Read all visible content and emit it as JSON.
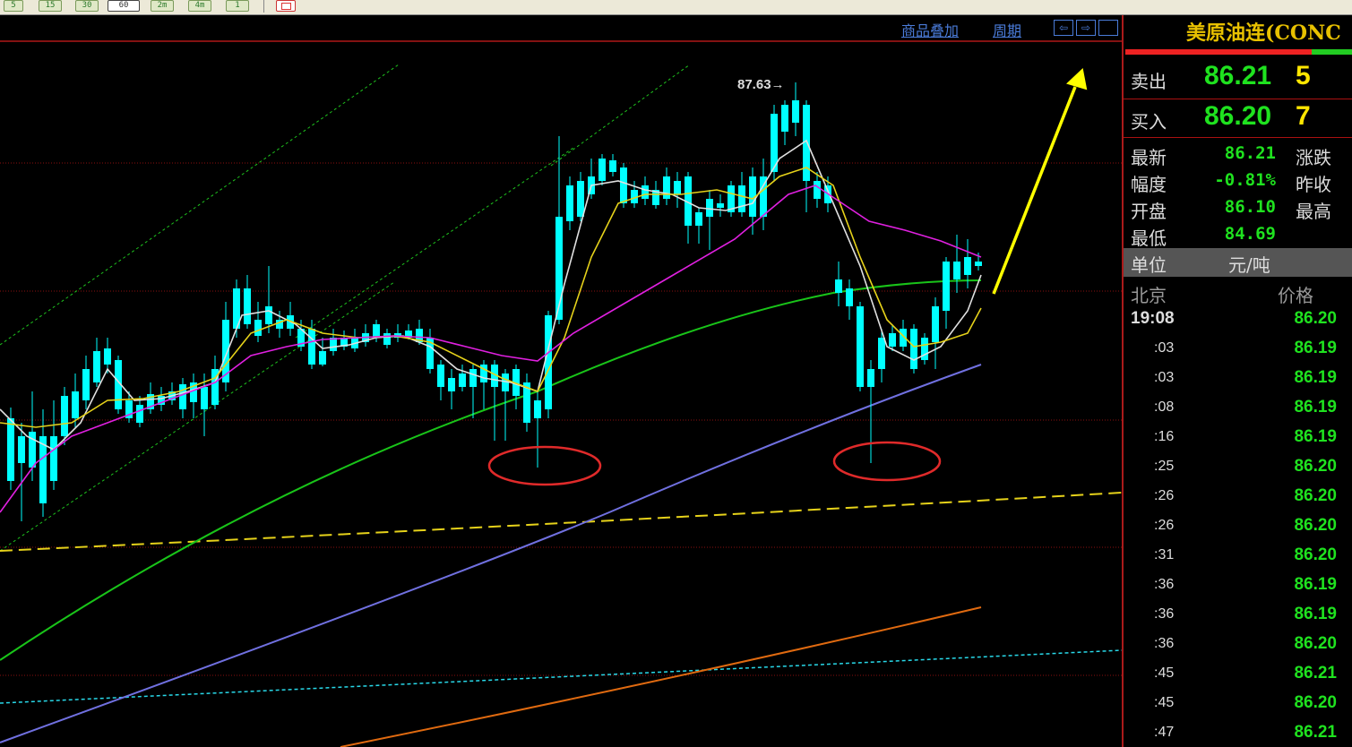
{
  "toolbar": {
    "buttons": [
      "5",
      "15",
      "30",
      "60",
      "2m",
      "4m",
      "1"
    ],
    "active": "60"
  },
  "chart": {
    "menu_overlay": "商品叠加",
    "menu_period": "周期",
    "high_label": "87.63→",
    "colors": {
      "up": "#ff3b3b",
      "down": "#00ffff",
      "ma5": "#e0e0e0",
      "ma10": "#e6d21a",
      "ma20": "#e020e0",
      "ma60": "#19c419",
      "ma120": "#7070e0",
      "orange": "#e06a10",
      "arrow": "#ffff00"
    }
  },
  "quote": {
    "title": "美原油连(CONC",
    "sell_label": "卖出",
    "sell_price": "86.21",
    "sell_vol": "5",
    "buy_label": "买入",
    "buy_price": "86.20",
    "buy_vol": "7",
    "latest_label": "最新",
    "latest_value": "86.21",
    "change_label": "涨跌",
    "amp_label": "幅度",
    "amp_value": "-0.81%",
    "prev_close_label": "昨收",
    "open_label": "开盘",
    "open_value": "86.10",
    "high_label": "最高",
    "low_label": "最低",
    "low_value": "84.69",
    "unit_label": "单位",
    "unit_value": "元/吨",
    "city_label": "北京",
    "price_col_label": "价格",
    "ticks": [
      {
        "time": "19:08",
        "price": "86.20"
      },
      {
        "time": ":03",
        "price": "86.19"
      },
      {
        "time": ":03",
        "price": "86.19"
      },
      {
        "time": ":08",
        "price": "86.19"
      },
      {
        "time": ":16",
        "price": "86.19"
      },
      {
        "time": ":25",
        "price": "86.20"
      },
      {
        "time": ":26",
        "price": "86.20"
      },
      {
        "time": ":26",
        "price": "86.20"
      },
      {
        "time": ":31",
        "price": "86.20"
      },
      {
        "time": ":36",
        "price": "86.19"
      },
      {
        "time": ":36",
        "price": "86.19"
      },
      {
        "time": ":36",
        "price": "86.20"
      },
      {
        "time": ":45",
        "price": "86.21"
      },
      {
        "time": ":45",
        "price": "86.20"
      },
      {
        "time": ":47",
        "price": "86.21"
      }
    ]
  }
}
